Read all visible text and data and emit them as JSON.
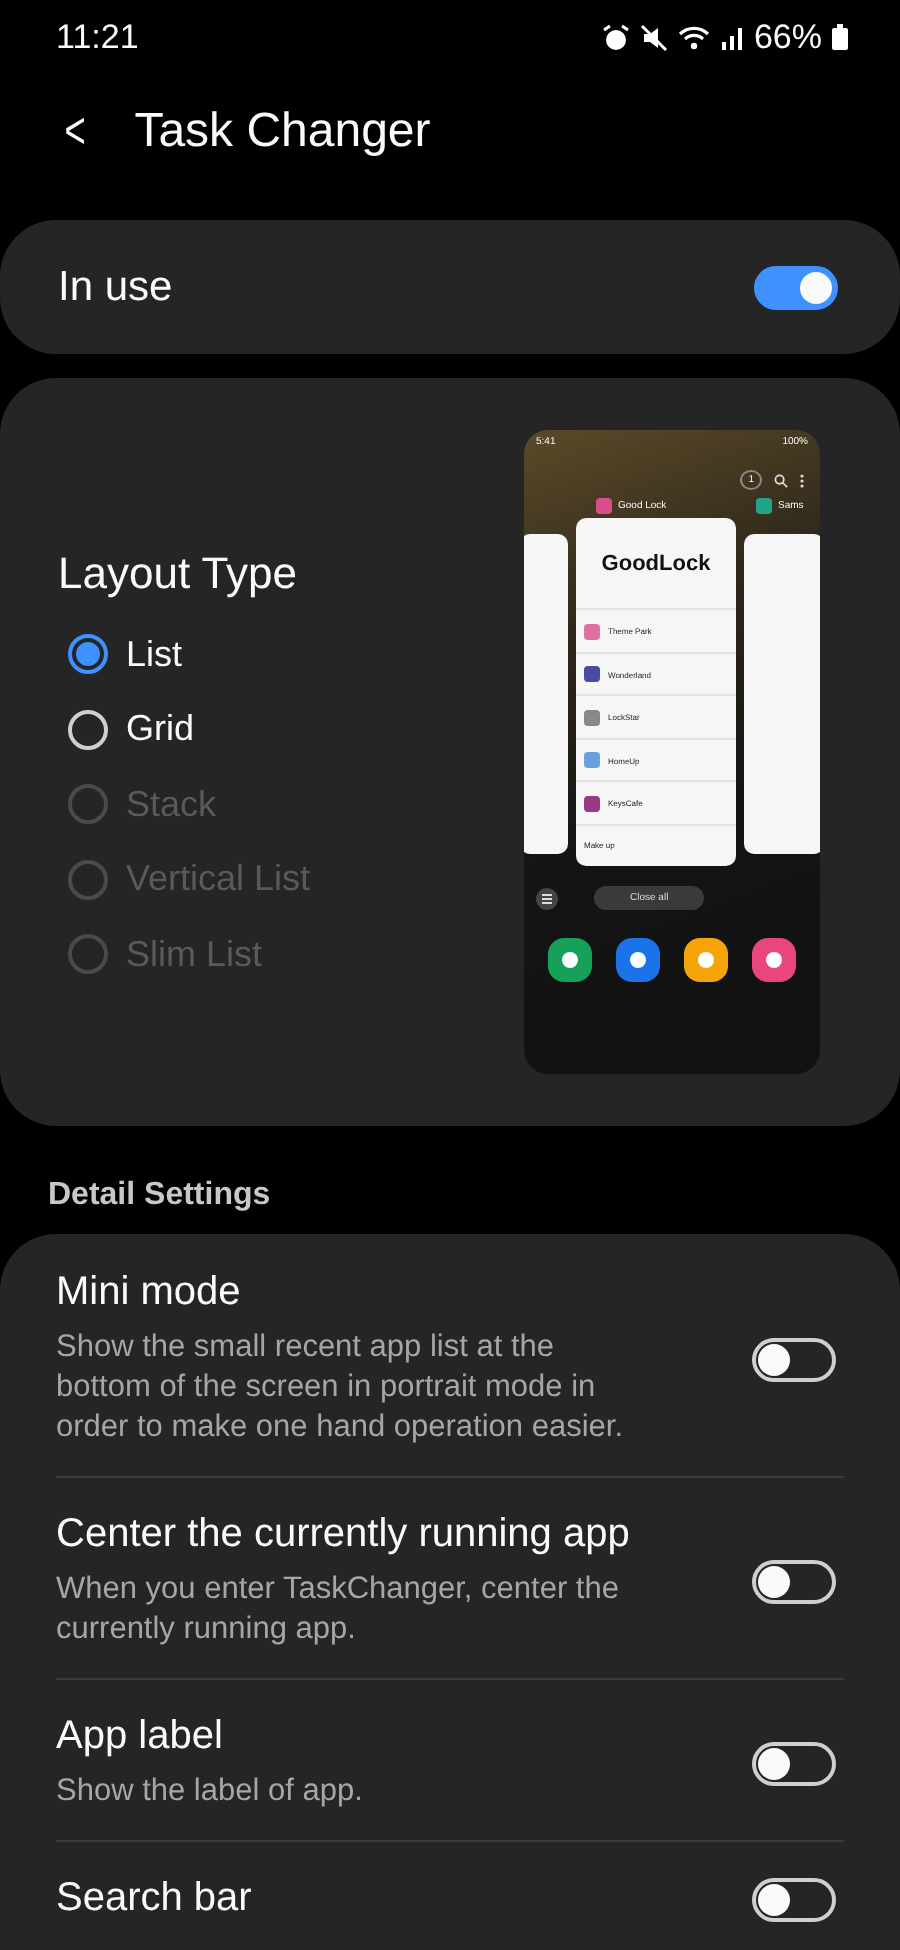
{
  "status_bar": {
    "time": "11:21",
    "battery": "66%"
  },
  "header": {
    "back": "<",
    "title": "Task Changer"
  },
  "master_switch": {
    "label": "In use",
    "on": true
  },
  "layout_type": {
    "title": "Layout Type",
    "options": [
      {
        "label": "List",
        "selected": true,
        "disabled": false
      },
      {
        "label": "Grid",
        "selected": false,
        "disabled": false
      },
      {
        "label": "Stack",
        "selected": false,
        "disabled": true
      },
      {
        "label": "Vertical List",
        "selected": false,
        "disabled": true
      },
      {
        "label": "Slim List",
        "selected": false,
        "disabled": true
      }
    ],
    "preview": {
      "time": "5:41",
      "battery": "100%",
      "count": "1",
      "app_name": "Good Lock",
      "next_app_name": "Sams",
      "logo": "GoodLock",
      "items": [
        "Theme Park",
        "Wonderland",
        "LockStar",
        "HomeUp",
        "KeysCafe"
      ],
      "footer": "Make up",
      "close_all": "Close all"
    }
  },
  "section_title": "Detail Settings",
  "settings": [
    {
      "title": "Mini mode",
      "description": "Show the small recent app list at the bottom of the screen in portrait mode in order to make one hand operation easier.",
      "on": false
    },
    {
      "title": "Center the currently running app",
      "description": "When you enter TaskChanger, center the currently running app.",
      "on": false
    },
    {
      "title": "App label",
      "description": "Show the label of app.",
      "on": false
    },
    {
      "title": "Search bar",
      "on": false
    }
  ]
}
